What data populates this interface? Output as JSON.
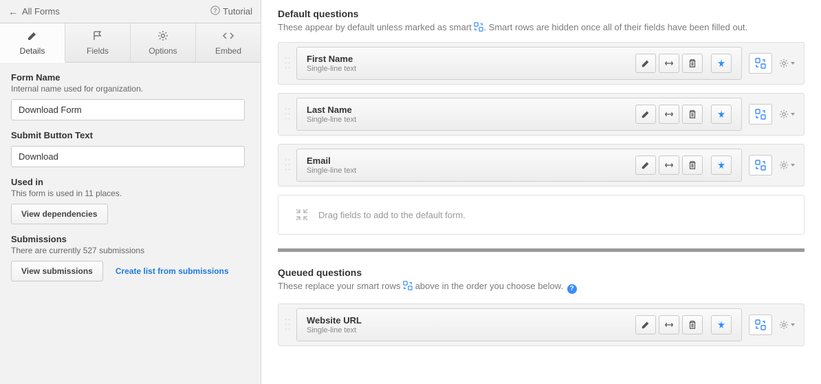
{
  "topbar": {
    "back_label": "All Forms",
    "tutorial_label": "Tutorial"
  },
  "tabs": [
    {
      "label": "Details",
      "icon": "pencil"
    },
    {
      "label": "Fields",
      "icon": "flag"
    },
    {
      "label": "Options",
      "icon": "gear"
    },
    {
      "label": "Embed",
      "icon": "code"
    }
  ],
  "form_name": {
    "label": "Form Name",
    "help": "Internal name used for organization.",
    "value": "Download Form"
  },
  "submit_button": {
    "label": "Submit Button Text",
    "value": "Download"
  },
  "used_in": {
    "label": "Used in",
    "help": "This form is used in 11 places.",
    "button": "View dependencies"
  },
  "submissions": {
    "label": "Submissions",
    "help": "There are currently 527 submissions",
    "button": "View submissions",
    "link": "Create list from submissions"
  },
  "default_section": {
    "heading": "Default questions",
    "sub_pre": "These appear by default unless marked as smart ",
    "sub_post": ". Smart rows are hidden once all of their fields have been filled out.",
    "fields": [
      {
        "title": "First Name",
        "type": "Single-line text"
      },
      {
        "title": "Last Name",
        "type": "Single-line text"
      },
      {
        "title": "Email",
        "type": "Single-line text"
      }
    ],
    "drop_text": "Drag fields to add to the default form."
  },
  "queued_section": {
    "heading": "Queued questions",
    "sub_pre": "These replace your smart rows ",
    "sub_post": " above in the order you choose below. ",
    "fields": [
      {
        "title": "Website URL",
        "type": "Single-line text"
      }
    ]
  }
}
